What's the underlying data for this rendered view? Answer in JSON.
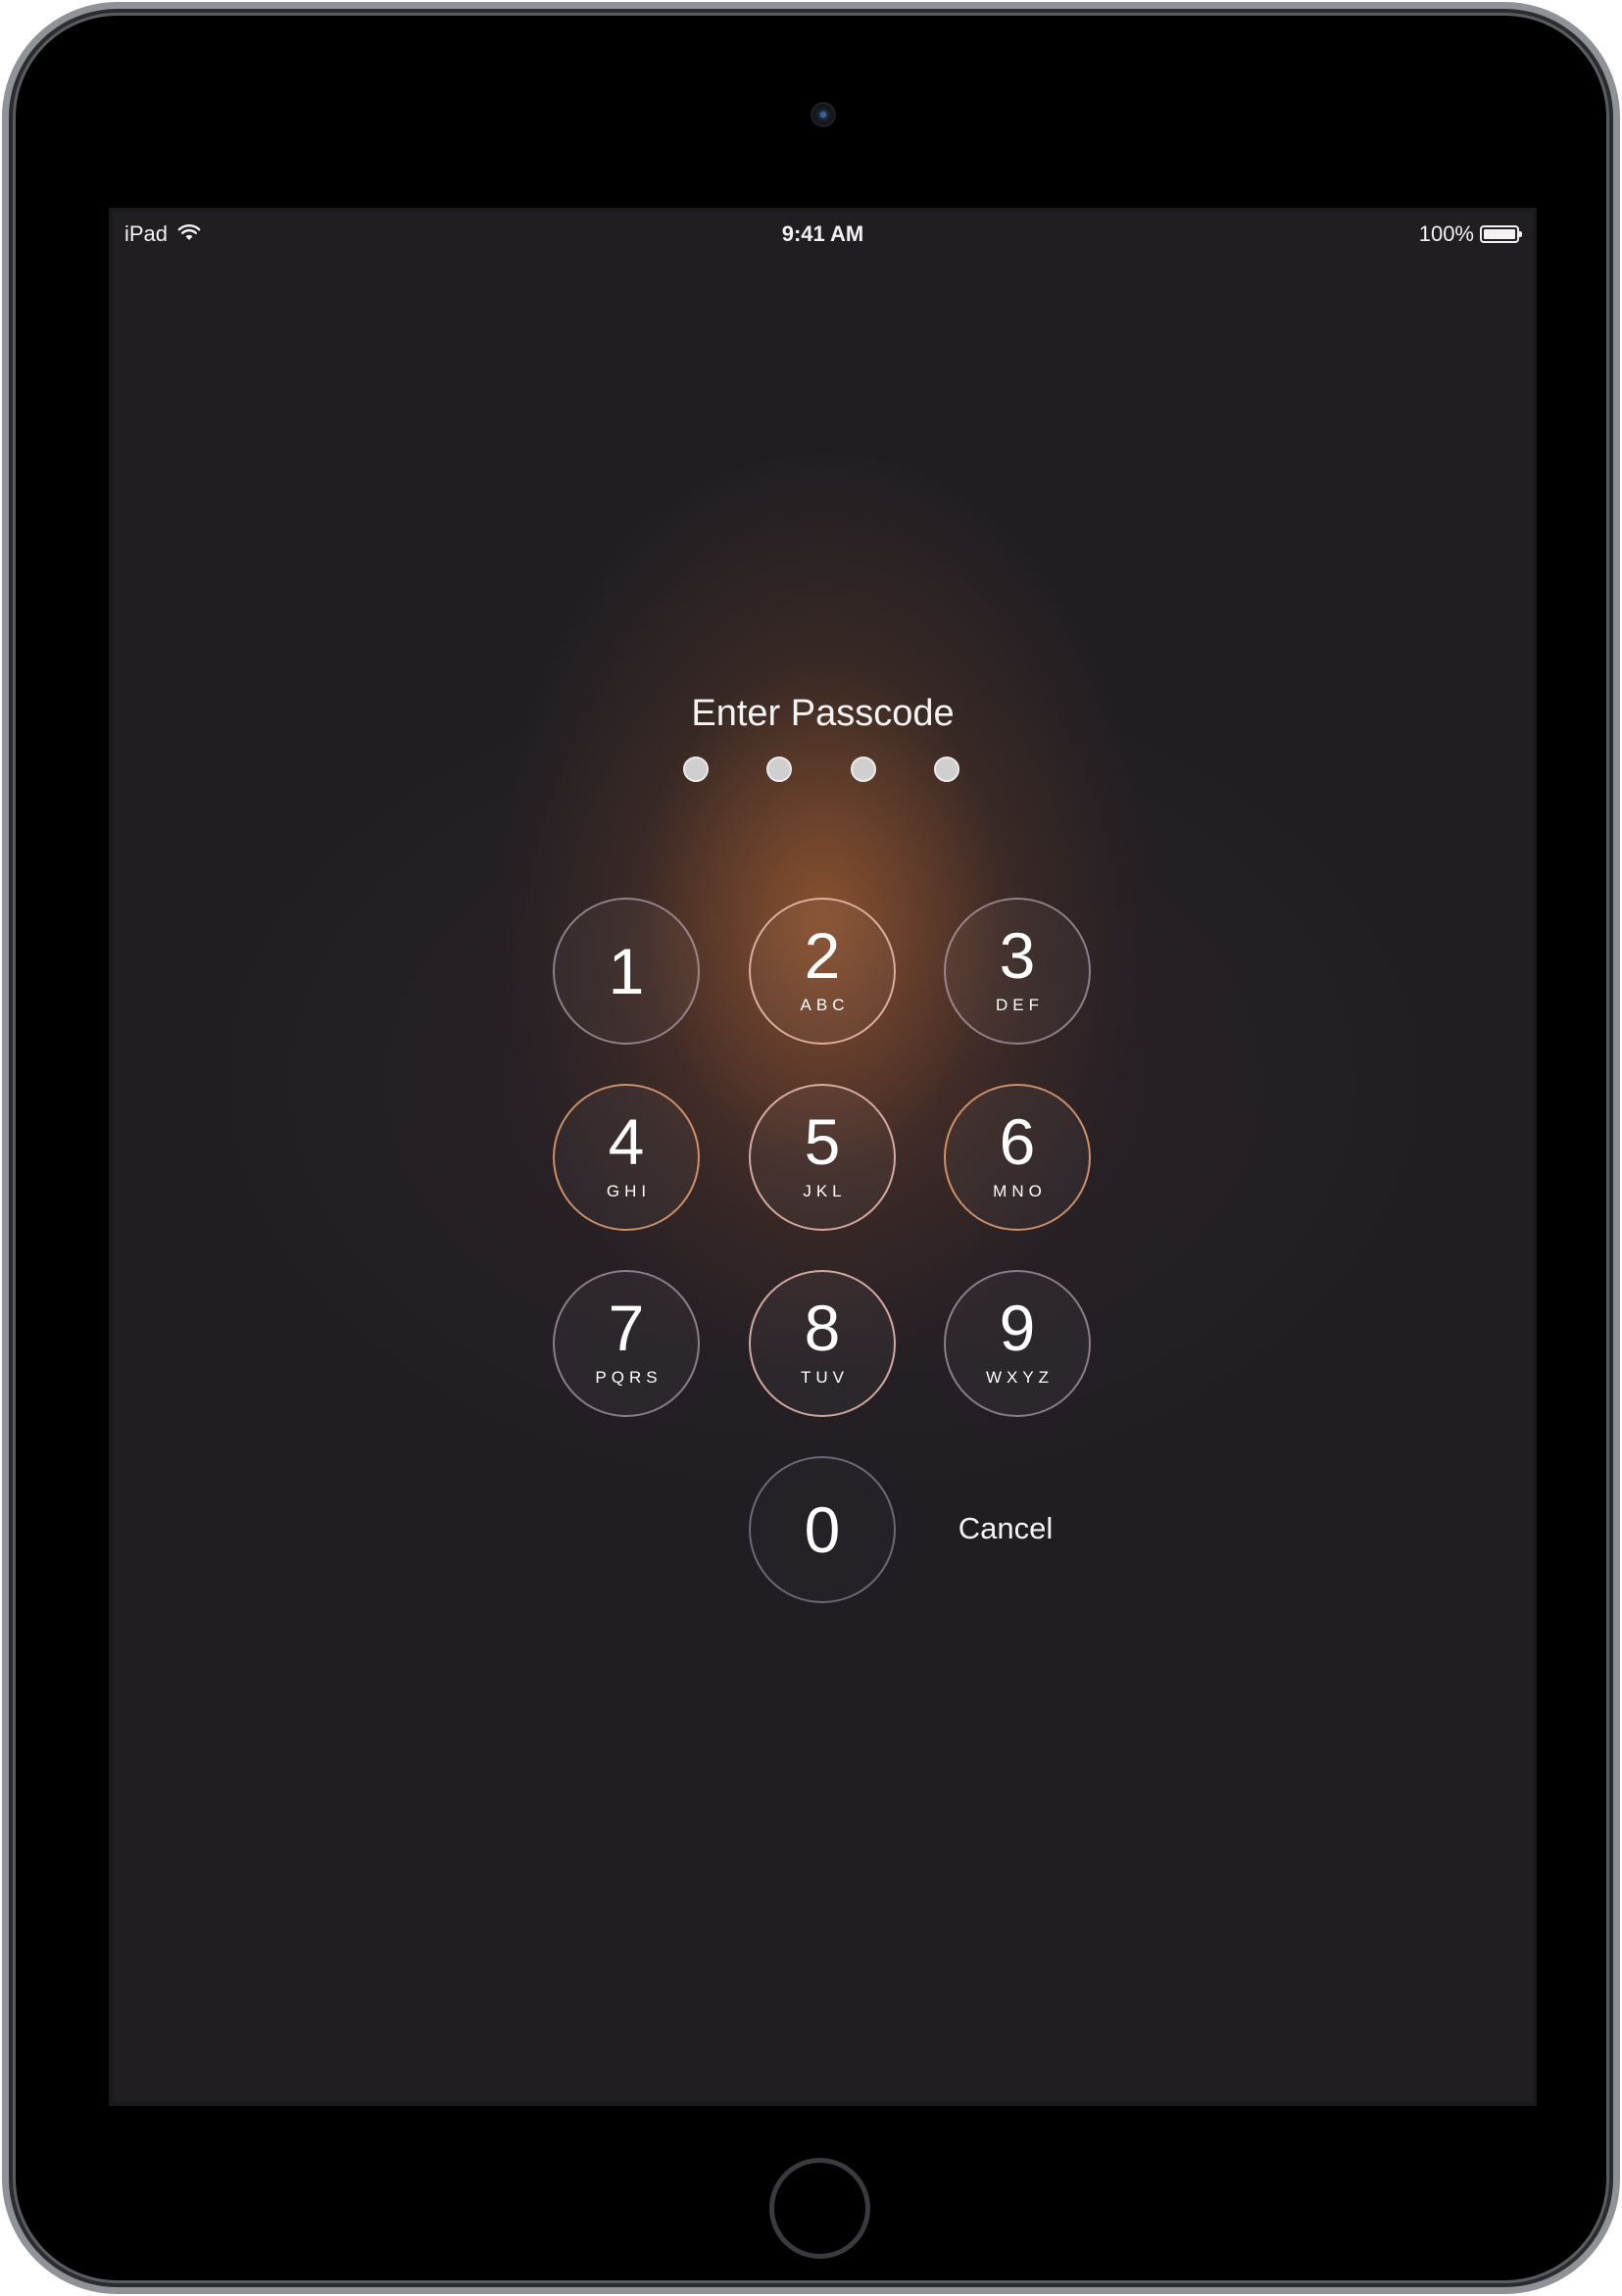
{
  "status_bar": {
    "device_name": "iPad",
    "time": "9:41 AM",
    "battery_percent": "100%",
    "battery_level": 1.0,
    "wifi_icon": "wifi-icon",
    "battery_icon": "battery-icon"
  },
  "lock_screen": {
    "prompt": "Enter Passcode",
    "passcode_length": 4,
    "entered_digits": 0,
    "keypad": [
      {
        "digit": "1",
        "letters": ""
      },
      {
        "digit": "2",
        "letters": "ABC"
      },
      {
        "digit": "3",
        "letters": "DEF"
      },
      {
        "digit": "4",
        "letters": "GHI"
      },
      {
        "digit": "5",
        "letters": "JKL"
      },
      {
        "digit": "6",
        "letters": "MNO"
      },
      {
        "digit": "7",
        "letters": "PQRS"
      },
      {
        "digit": "8",
        "letters": "TUV"
      },
      {
        "digit": "9",
        "letters": "WXYZ"
      },
      {
        "digit": "0",
        "letters": ""
      }
    ],
    "cancel_label": "Cancel"
  },
  "colors": {
    "background": "#211e23",
    "glow": "#be6e32",
    "text": "#f4f4f4"
  }
}
